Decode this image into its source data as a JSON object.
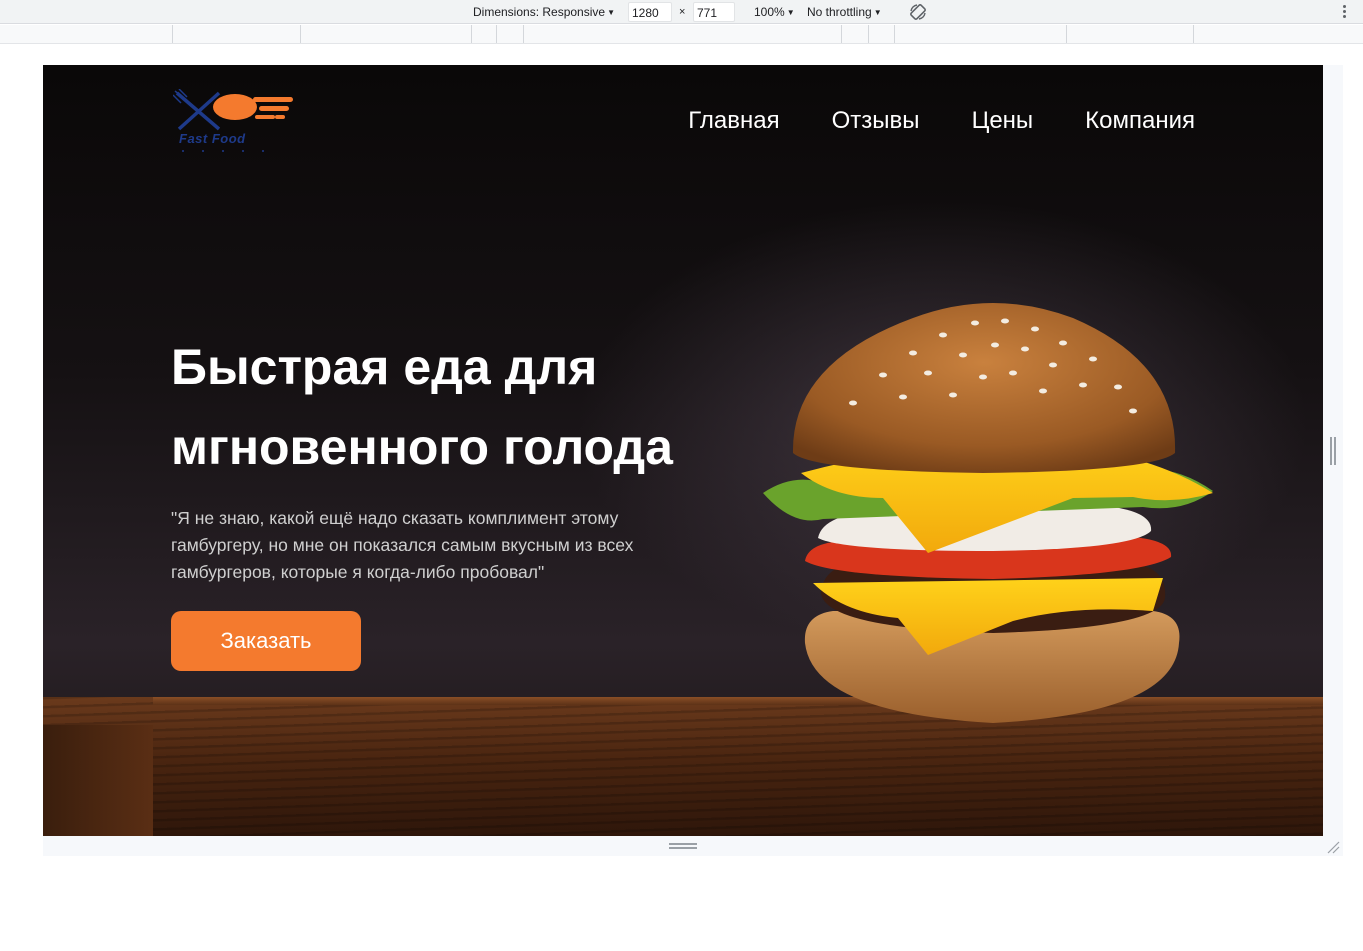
{
  "devtools": {
    "dimensions_label": "Dimensions: Responsive",
    "width_value": "1280",
    "times": "×",
    "height_value": "771",
    "zoom": "100%",
    "throttling": "No throttling",
    "rotate_icon": "rotate-icon",
    "more_icon": "kebab-menu-icon"
  },
  "site": {
    "logo_text": "Fast Food",
    "nav": [
      "Главная",
      "Отзывы",
      "Цены",
      "Компания"
    ],
    "title_line1": "Быстрая еда для",
    "title_line2": "мгновенного голода",
    "quote": "\"Я не знаю, какой ещё надо сказать комплимент этому гамбургеру, но мне он показался самым вкусным из всех гамбургеров, которые я когда-либо пробовал\"",
    "order_button": "Заказать"
  },
  "colors": {
    "accent": "#f47a2e",
    "logo_blue": "#1e3a8a",
    "background": "#0c0a0a"
  }
}
